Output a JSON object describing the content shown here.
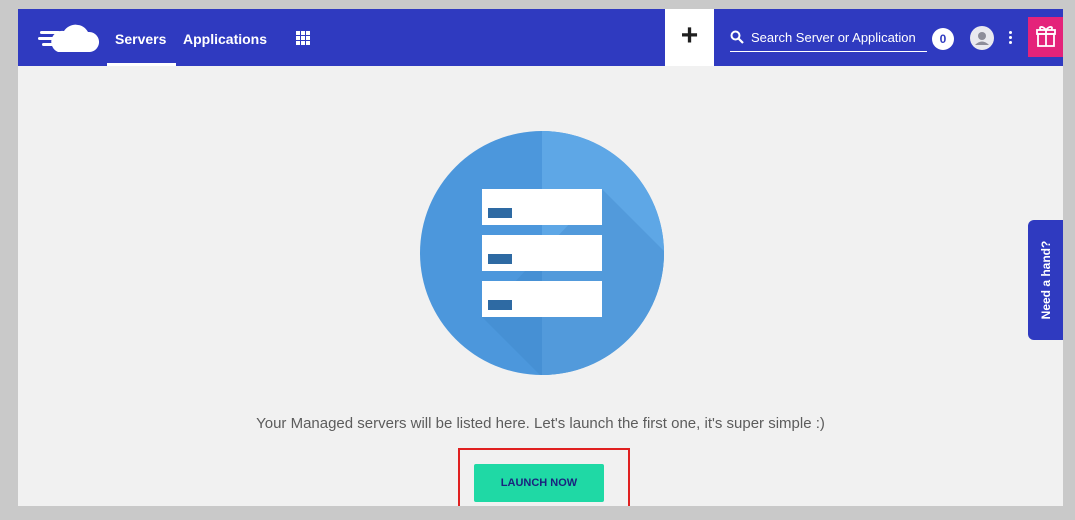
{
  "nav": {
    "tabs": [
      {
        "label": "Servers",
        "active": true
      },
      {
        "label": "Applications",
        "active": false
      }
    ],
    "add_label": "+",
    "search": {
      "placeholder": "Search Server or Application"
    },
    "notification_count": "0",
    "icons": [
      "logo-cloud-icon",
      "apps-grid-icon",
      "search-icon",
      "user-avatar-icon",
      "kebab-menu-icon",
      "gift-icon"
    ]
  },
  "empty_state": {
    "message": "Your Managed servers will be listed here. Let's launch the first one, it's super simple :)",
    "cta_label": "LAUNCH NOW",
    "icon": "server-stack-icon"
  },
  "help": {
    "label": "Need a hand?"
  },
  "colors": {
    "brand": "#2f3ac0",
    "gift": "#e4237a",
    "cta": "#1fd9a5",
    "illustration": "#5aa2e0",
    "highlight": "#e02020"
  }
}
